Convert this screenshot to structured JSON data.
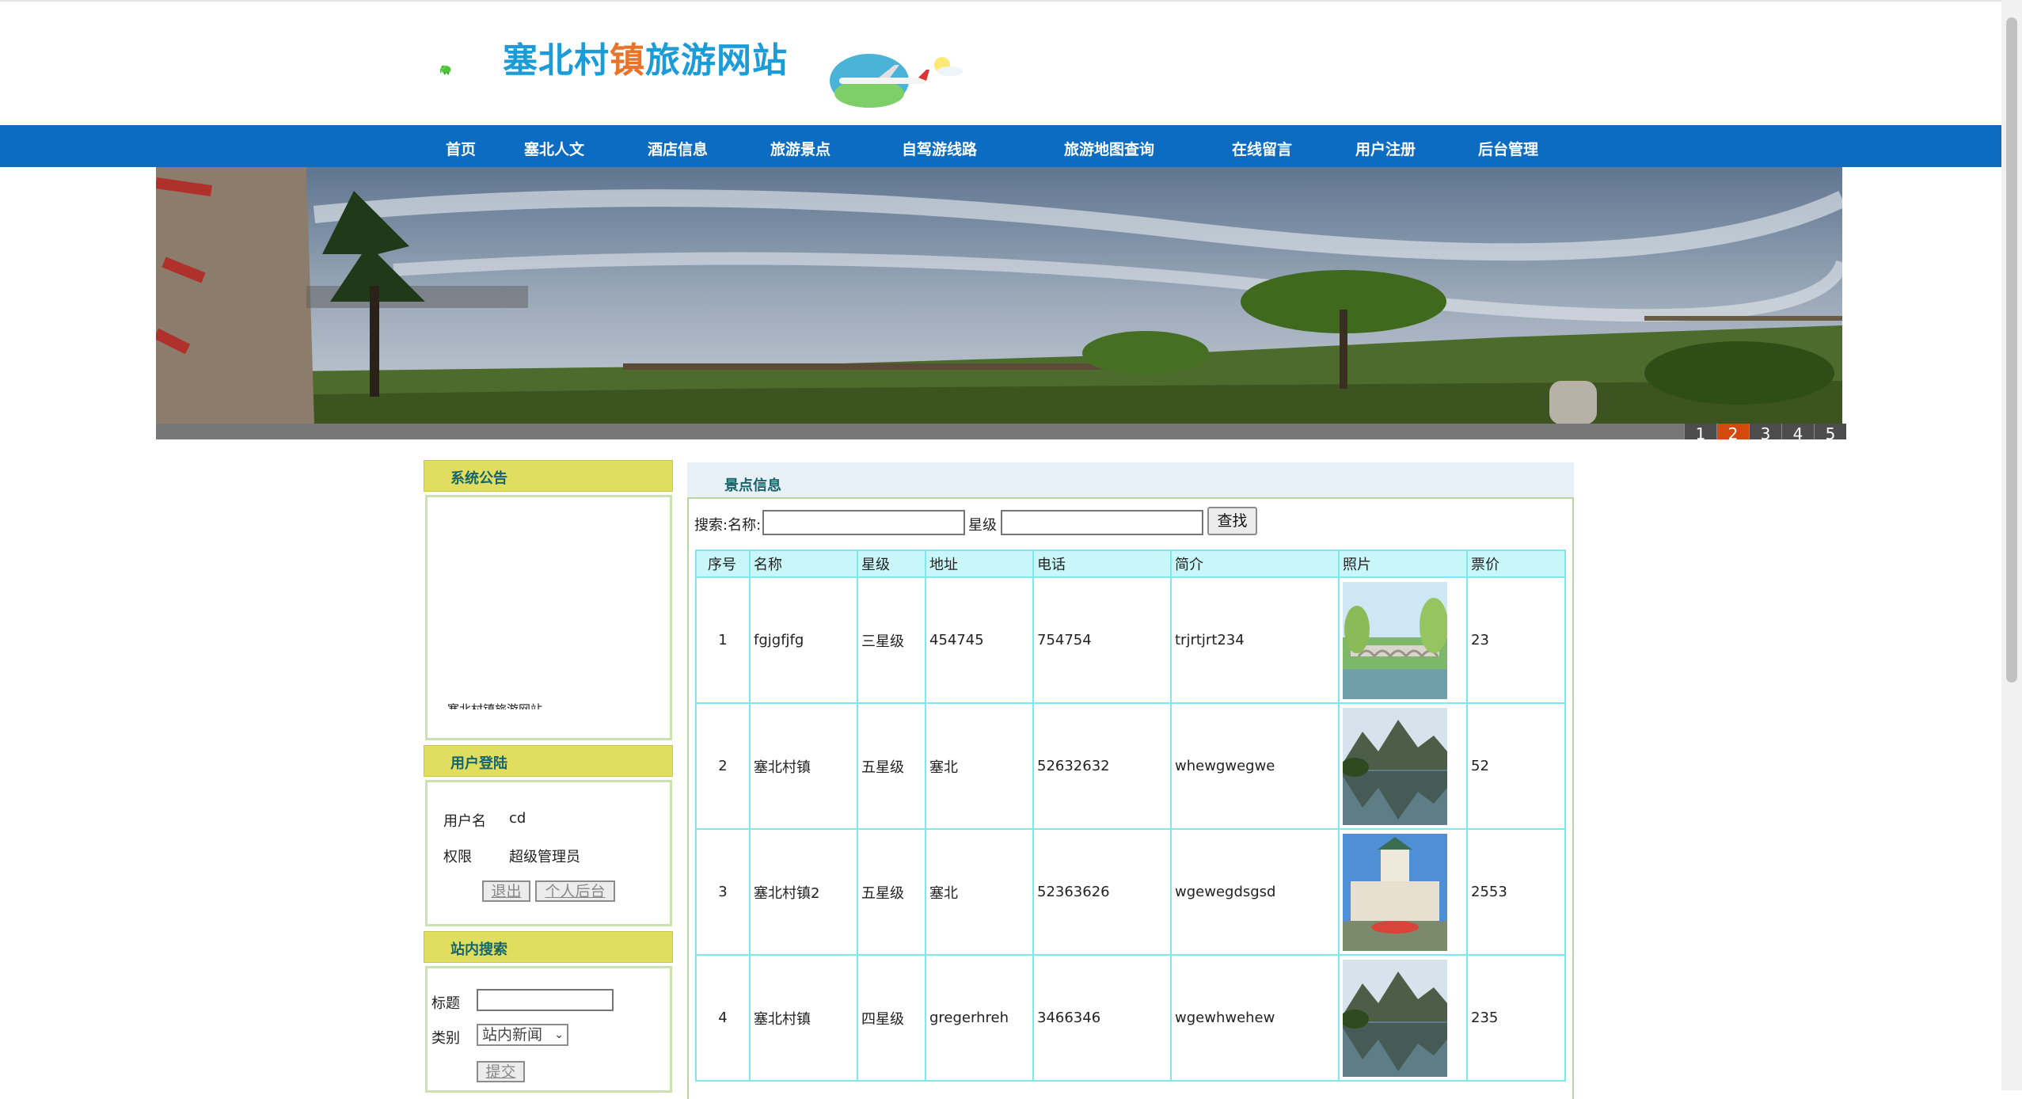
{
  "site": {
    "title_part1": "塞北村",
    "title_part2": "镇",
    "title_part3": "旅游网站"
  },
  "nav": [
    "首页",
    "塞北人文",
    "酒店信息",
    "旅游景点",
    "自驾游线路",
    "旅游地图查询",
    "在线留言",
    "用户注册",
    "后台管理"
  ],
  "banner": {
    "pages": [
      "1",
      "2",
      "3",
      "4",
      "5"
    ],
    "active_page": "2"
  },
  "notice": {
    "heading": "系统公告",
    "text": "塞北村镇旅游网站"
  },
  "login": {
    "heading": "用户登陆",
    "username_label": "用户名",
    "username_value": "cd",
    "role_label": "权限",
    "role_value": "超级管理员",
    "logout_label": "退出",
    "personal_label": "个人后台"
  },
  "site_search": {
    "heading": "站内搜索",
    "title_label": "标题",
    "title_value": "",
    "type_label": "类别",
    "type_value": "站内新闻",
    "submit_label": "提交"
  },
  "spots": {
    "heading": "景点信息",
    "search_name_label": "搜索:名称:",
    "search_name_value": "",
    "search_level_label": "星级",
    "search_level_value": "",
    "search_button": "查找",
    "columns": [
      "序号",
      "名称",
      "星级",
      "地址",
      "电话",
      "简介",
      "照片",
      "票价"
    ],
    "rows": [
      {
        "no": "1",
        "name": "fgjgfjfg",
        "level": "三星级",
        "address": "454745",
        "phone": "754754",
        "intro": "trjrtjrt234",
        "photo": "bridge-photo",
        "price": "23"
      },
      {
        "no": "2",
        "name": "塞北村镇",
        "level": "五星级",
        "address": "塞北",
        "phone": "52632632",
        "intro": "whewgwegwe",
        "photo": "lake-mountain-photo",
        "price": "52"
      },
      {
        "no": "3",
        "name": "塞北村镇2",
        "level": "五星级",
        "address": "塞北",
        "phone": "52363626",
        "intro": "wgewegdsgsd",
        "photo": "tower-photo",
        "price": "2553"
      },
      {
        "no": "4",
        "name": "塞北村镇",
        "level": "四星级",
        "address": "gregerhreh",
        "phone": "3466346",
        "intro": "wgewhwehew",
        "photo": "lake-mountain-photo",
        "price": "235"
      }
    ]
  },
  "colors": {
    "nav_bg": "#0b6cc2",
    "side_header_bg": "#e1dd5f",
    "side_header_text": "#15656a",
    "table_border": "#7ee8ee",
    "active_slide": "#d44a0e"
  }
}
